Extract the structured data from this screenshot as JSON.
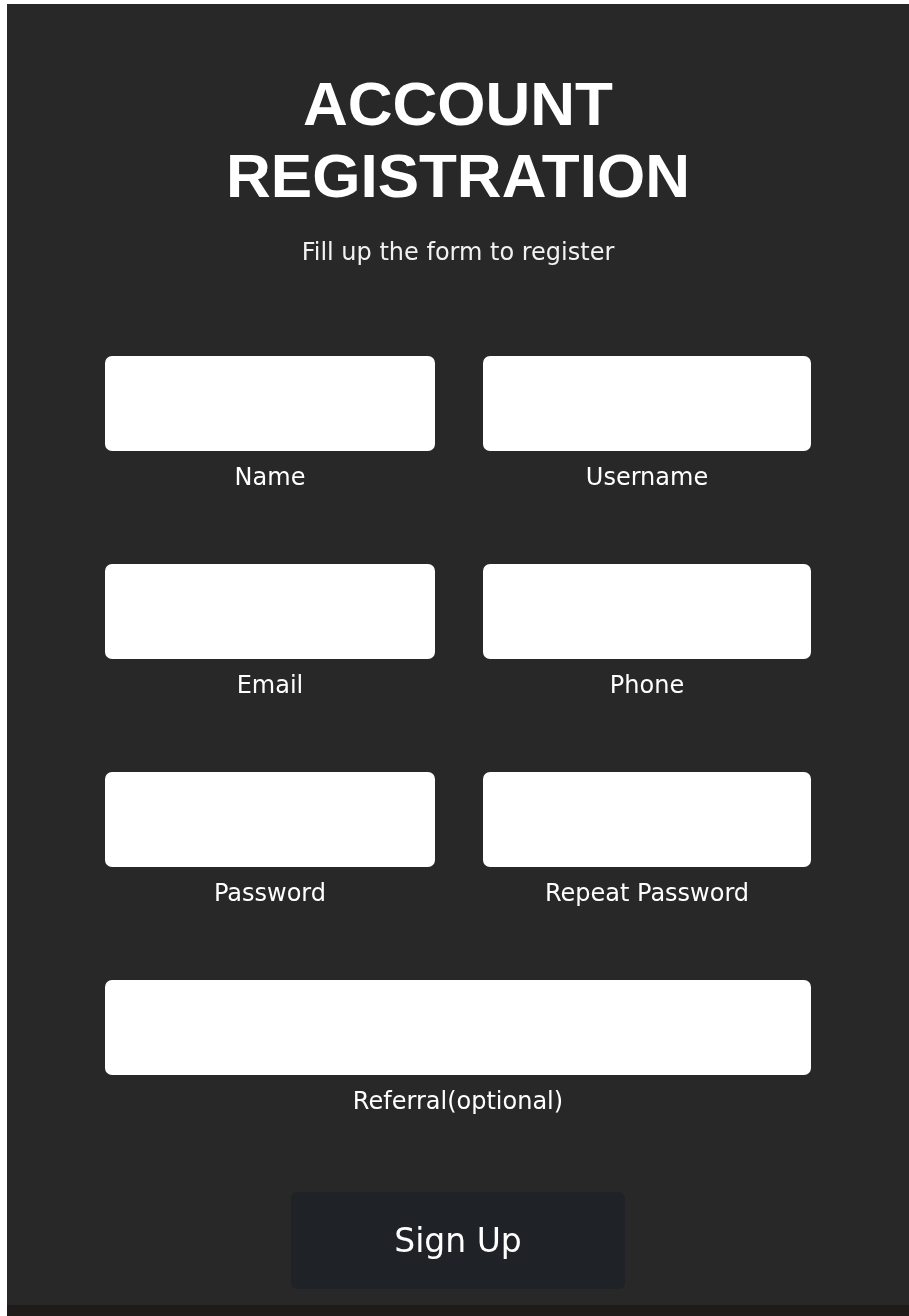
{
  "title": "ACCOUNT REGISTRATION",
  "subtitle": "Fill up the form to register",
  "fields": [
    {
      "label": "Name",
      "kind": "half"
    },
    {
      "label": "Username",
      "kind": "half"
    },
    {
      "label": "Email",
      "kind": "half"
    },
    {
      "label": "Phone",
      "kind": "half"
    },
    {
      "label": "Password",
      "kind": "half"
    },
    {
      "label": "Repeat Password",
      "kind": "half"
    },
    {
      "label": "Referral(optional)",
      "kind": "full"
    }
  ],
  "button": "Sign Up"
}
